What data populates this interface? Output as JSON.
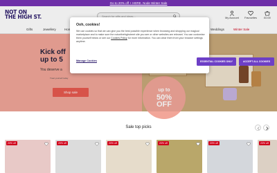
{
  "promo": {
    "text": "Go to 20% off + HERE. Node Winter Sale"
  },
  "header": {
    "logo_line1": "NOT ON",
    "logo_line2": "THE HIGH ST.",
    "search_placeholder": "Search for gifts and ideas...",
    "my_account": "My Account",
    "favourites": "Favourites",
    "basket": "£0.00"
  },
  "nav": {
    "items": [
      "Gifts",
      "Jewellery",
      "Home",
      "",
      "",
      "",
      "",
      "",
      "",
      "Weddings",
      "Winter Sale"
    ]
  },
  "hero": {
    "title_line1": "Kick off",
    "title_line2": "up to 5",
    "subtitle": "You deserve a",
    "small_text": "Treat yourself today",
    "button": "Shop sale",
    "badge_up": "up to",
    "badge_pct": "50%",
    "badge_off": "OFF"
  },
  "cookie_modal": {
    "title": "Ooh, cookies!",
    "body_start": "We use cookies so that we can give you the best possible experience when browsing and shopping our magical marketplace and to make sure the notonthehighstreet site you see or other websites are relevant. You can customise them yourself below or see our ",
    "body_link": "Cookies Policy",
    "body_end": " for more information. You can clear them from your browser settings anytime.",
    "manage": "Manage Cookies",
    "essential_btn": "ESSENTIAL COOKIES ONLY",
    "accept_btn": "ACCEPT ALL COOKIES"
  },
  "sale": {
    "title": "Sale top picks",
    "cards": [
      {
        "badge": "20% off"
      },
      {
        "badge": "20% off"
      },
      {
        "badge": "20% off"
      },
      {
        "badge": "20% off"
      },
      {
        "badge": "20% off"
      },
      {
        "badge": "20% off"
      }
    ]
  },
  "colors": {
    "promo_bg": "#6e2fa8",
    "hero_bg": "#f2a699",
    "cta": "#e85a4f",
    "cookie_btn": "#6d3fc6",
    "sale_red": "#d0021b"
  }
}
